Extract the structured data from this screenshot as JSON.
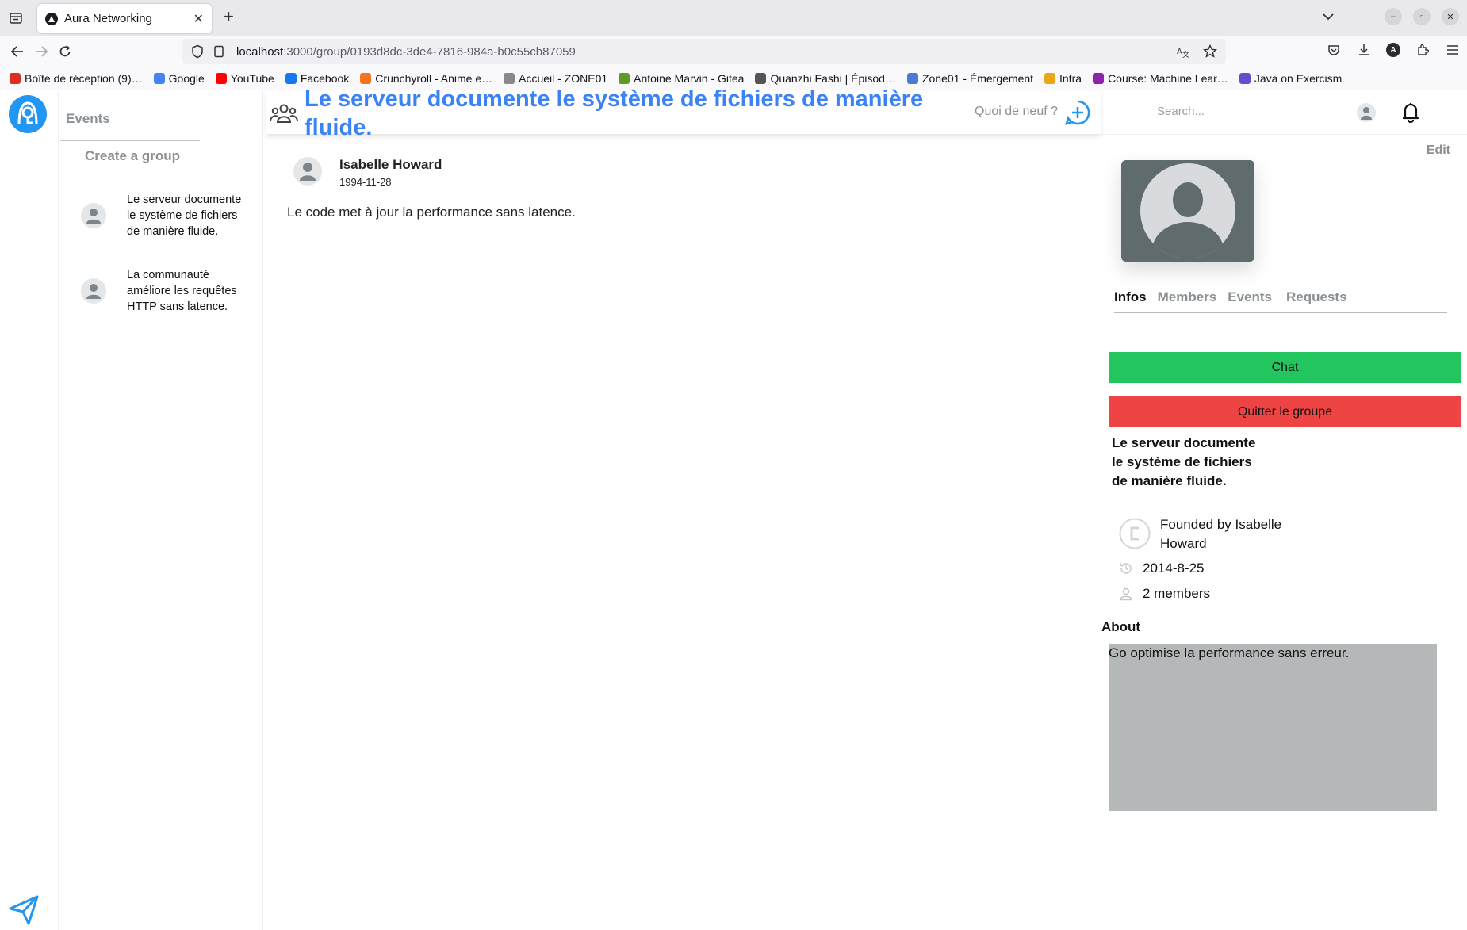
{
  "browser": {
    "tab_title": "Aura Networking",
    "url_host": "localhost",
    "url_path": ":3000/group/0193d8dc-3de4-7816-984a-b0c55cb87059",
    "account_initial": "A",
    "bookmarks": [
      {
        "label": "Boîte de réception (9)…",
        "icon": "gmail-icon",
        "color": "#d93025"
      },
      {
        "label": "Google",
        "icon": "google-icon",
        "color": "#4285f4"
      },
      {
        "label": "YouTube",
        "icon": "youtube-icon",
        "color": "#ff0000"
      },
      {
        "label": "Facebook",
        "icon": "facebook-icon",
        "color": "#1877f2"
      },
      {
        "label": "Crunchyroll - Anime e…",
        "icon": "crunchyroll-icon",
        "color": "#f47521"
      },
      {
        "label": "Accueil - ZONE01",
        "icon": "zone01-icon",
        "color": "#888888"
      },
      {
        "label": "Antoine Marvin - Gitea",
        "icon": "gitea-icon",
        "color": "#609926"
      },
      {
        "label": "Quanzhi Fashi | Épisod…",
        "icon": "globe-icon",
        "color": "#555555"
      },
      {
        "label": "Zone01 - Émergement",
        "icon": "zone01-icon",
        "color": "#4b7bd8"
      },
      {
        "label": "Intra",
        "icon": "code-icon",
        "color": "#e6a817"
      },
      {
        "label": "Course: Machine Lear…",
        "icon": "moodle-icon",
        "color": "#8e24aa"
      },
      {
        "label": "Java on Exercism",
        "icon": "exercism-icon",
        "color": "#604fcd"
      }
    ]
  },
  "sidebar": {
    "events_label": "Events",
    "create_group_label": "Create a group",
    "groups": [
      {
        "name": "Le serveur documente le système de fichiers de manière fluide."
      },
      {
        "name": "La communauté améliore les requêtes HTTP sans latence."
      }
    ]
  },
  "main": {
    "title": "Le serveur documente le système de fichiers de manière fluide.",
    "whats_new": "Quoi de neuf ?",
    "post": {
      "author": "Isabelle Howard",
      "date": "1994-11-28",
      "body": "Le code met à jour la performance sans latence."
    }
  },
  "right": {
    "search_placeholder": "Search...",
    "edit_label": "Edit",
    "tabs": [
      "Infos",
      "Members",
      "Events",
      "Requests"
    ],
    "active_tab": "Infos",
    "chat_label": "Chat",
    "quit_label": "Quitter le groupe",
    "group_title": "Le serveur documente le système de fichiers de manière fluide.",
    "founded_by": "Founded by Isabelle Howard",
    "created": "2014-8-25",
    "members": "2 members",
    "about_heading": "About",
    "about_text": "Go optimise la performance sans erreur."
  },
  "colors": {
    "accent": "#3b82f6",
    "chat": "#22c55e",
    "quit": "#ef4444",
    "muted": "#8a9094"
  }
}
